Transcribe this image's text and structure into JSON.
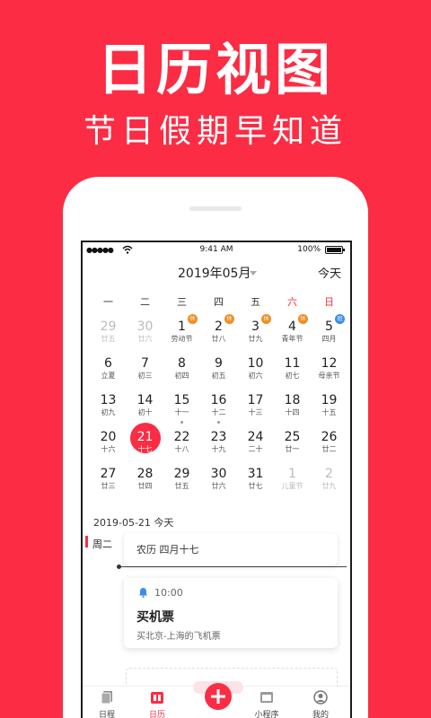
{
  "promo": {
    "title": "日历视图",
    "subtitle": "节日假期早知道"
  },
  "status_bar": {
    "signal": "●●●●●",
    "time": "9:41 AM",
    "battery": "100%"
  },
  "header": {
    "month": "2019年05月",
    "today_button": "今天"
  },
  "weekdays": [
    "一",
    "二",
    "三",
    "四",
    "五",
    "六",
    "日"
  ],
  "calendar": {
    "rows": [
      [
        {
          "d": "29",
          "s": "廿五",
          "muted": true
        },
        {
          "d": "30",
          "s": "廿六",
          "muted": true
        },
        {
          "d": "1",
          "s": "劳动节",
          "badge": "休"
        },
        {
          "d": "2",
          "s": "廿八",
          "badge": "休"
        },
        {
          "d": "3",
          "s": "廿九",
          "badge": "休"
        },
        {
          "d": "4",
          "s": "青年节",
          "badge": "休"
        },
        {
          "d": "5",
          "s": "四月",
          "badge": "班"
        }
      ],
      [
        {
          "d": "6",
          "s": "立夏"
        },
        {
          "d": "7",
          "s": "初三"
        },
        {
          "d": "8",
          "s": "初四"
        },
        {
          "d": "9",
          "s": "初五"
        },
        {
          "d": "10",
          "s": "初六"
        },
        {
          "d": "11",
          "s": "初七"
        },
        {
          "d": "12",
          "s": "母亲节"
        }
      ],
      [
        {
          "d": "13",
          "s": "初九"
        },
        {
          "d": "14",
          "s": "初十"
        },
        {
          "d": "15",
          "s": "十一",
          "dot": true
        },
        {
          "d": "16",
          "s": "十二",
          "dot": true
        },
        {
          "d": "17",
          "s": "十三"
        },
        {
          "d": "18",
          "s": "十四"
        },
        {
          "d": "19",
          "s": "十五"
        }
      ],
      [
        {
          "d": "20",
          "s": "十六"
        },
        {
          "d": "21",
          "s": "十七",
          "selected": true
        },
        {
          "d": "22",
          "s": "十八"
        },
        {
          "d": "23",
          "s": "十九"
        },
        {
          "d": "24",
          "s": "二十"
        },
        {
          "d": "25",
          "s": "廿一"
        },
        {
          "d": "26",
          "s": "廿二"
        }
      ],
      [
        {
          "d": "27",
          "s": "廿三"
        },
        {
          "d": "28",
          "s": "廿四"
        },
        {
          "d": "29",
          "s": "廿五"
        },
        {
          "d": "30",
          "s": "廿六"
        },
        {
          "d": "31",
          "s": "廿七"
        },
        {
          "d": "1",
          "s": "儿童节",
          "muted": true
        },
        {
          "d": "2",
          "s": "廿九",
          "muted": true
        }
      ]
    ]
  },
  "agenda": {
    "date_label": "2019-05-21 今天",
    "weekday": "周二",
    "lunar": "农历 四月十七",
    "event": {
      "time": "10:00",
      "title": "买机票",
      "desc": "买北京-上海的飞机票"
    }
  },
  "tabbar": {
    "items": [
      {
        "label": "日程",
        "icon": "schedule-icon"
      },
      {
        "label": "日历",
        "icon": "calendar-icon",
        "active": true
      },
      {
        "label": "",
        "icon": "plus-icon"
      },
      {
        "label": "小程序",
        "icon": "miniapp-icon"
      },
      {
        "label": "我的",
        "icon": "profile-icon"
      }
    ]
  },
  "colors": {
    "brand": "#fb2c44",
    "rest_badge": "#f08d22",
    "work_badge": "#3d8ee8"
  }
}
